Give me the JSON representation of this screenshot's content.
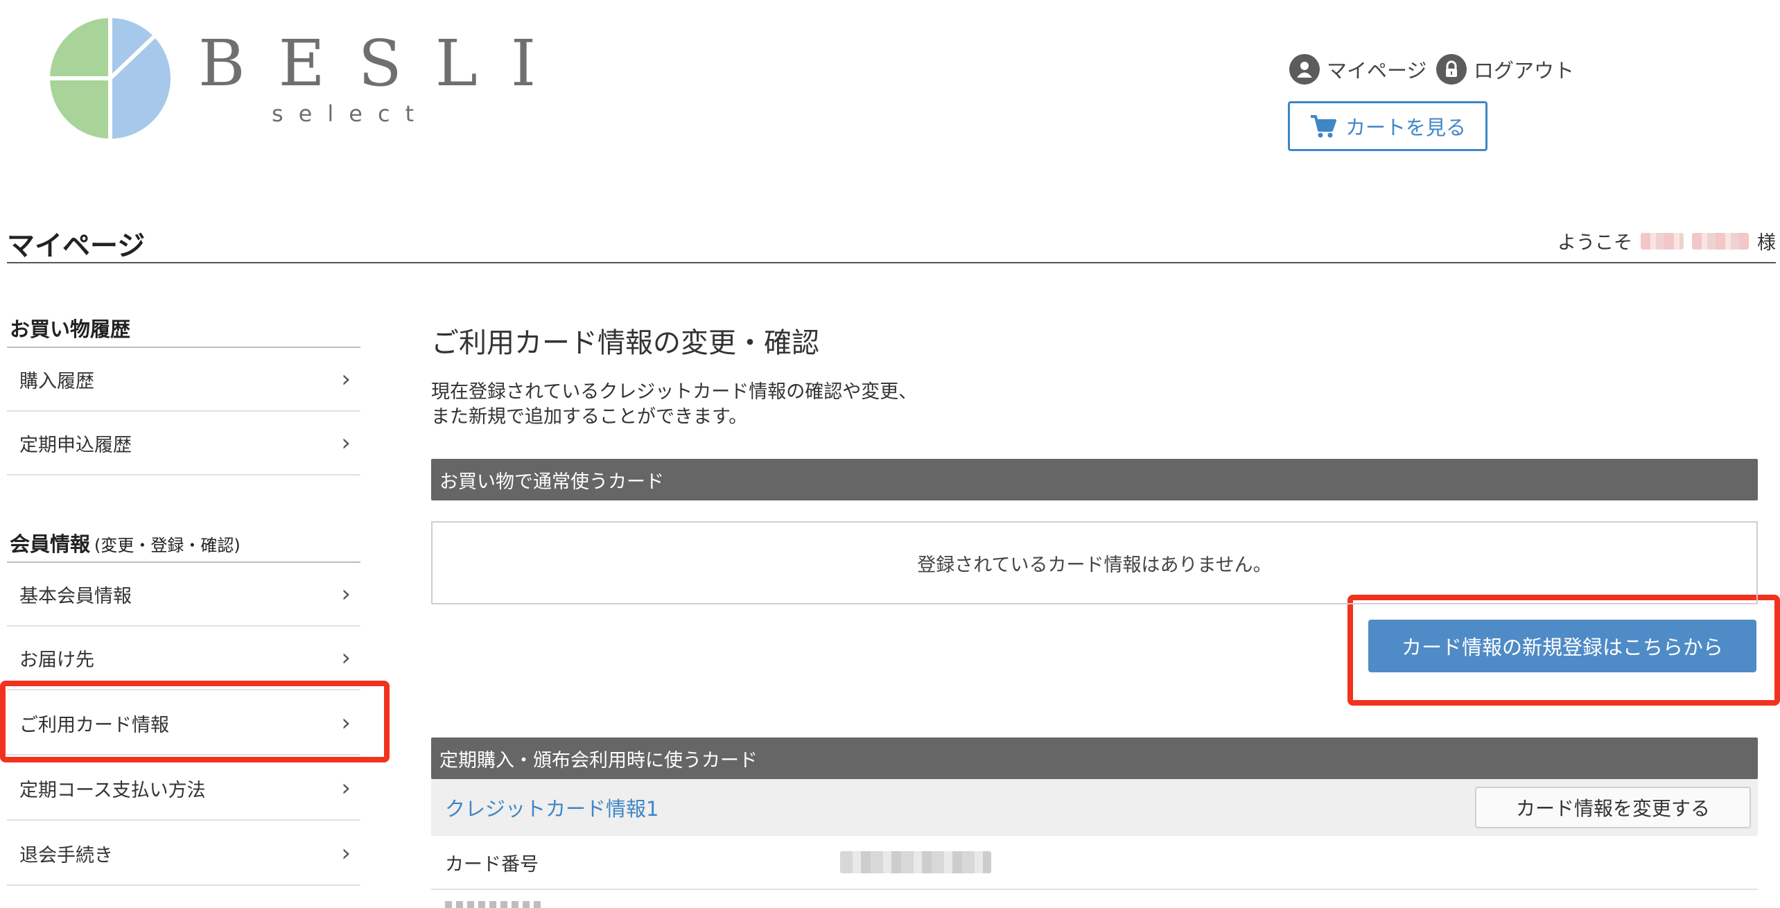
{
  "header": {
    "logo_word": "BESLI",
    "logo_sub": "select",
    "mypage_label": "マイページ",
    "logout_label": "ログアウト",
    "cart_label": "カートを見る",
    "accent_color": "#3f86c6"
  },
  "title_bar": {
    "page_title": "マイページ",
    "welcome_prefix": "ようこそ",
    "welcome_suffix": "様"
  },
  "sidebar": {
    "section1": "お買い物履歴",
    "section1_items": [
      "購入履歴",
      "定期申込履歴"
    ],
    "section2": "会員情報",
    "section2_note": "(変更・登録・確認)",
    "section2_items": [
      "基本会員情報",
      "お届け先",
      "ご利用カード情報",
      "定期コース支払い方法",
      "退会手続き"
    ],
    "chevron": "›",
    "highlight_color": "#f1321f"
  },
  "main": {
    "title": "ご利用カード情報の変更・確認",
    "description_line1": "現在登録されているクレジットカード情報の確認や変更、",
    "description_line2": "また新規で追加することができます。",
    "regular_card_header": "お買い物で通常使うカード",
    "no_card_message": "登録されているカード情報はありません。",
    "register_button": "カード情報の新規登録はこちらから",
    "subscription_card_header": "定期購入・頒布会利用時に使うカード",
    "card1_label": "クレジットカード情報1",
    "change_button": "カード情報を変更する",
    "card_number_label": "カード番号"
  },
  "icons": {
    "logo": "pie-logo-icon",
    "mypage": "user-icon",
    "logout": "lock-icon",
    "cart": "cart-icon",
    "chevron": "chevron-right-icon"
  }
}
